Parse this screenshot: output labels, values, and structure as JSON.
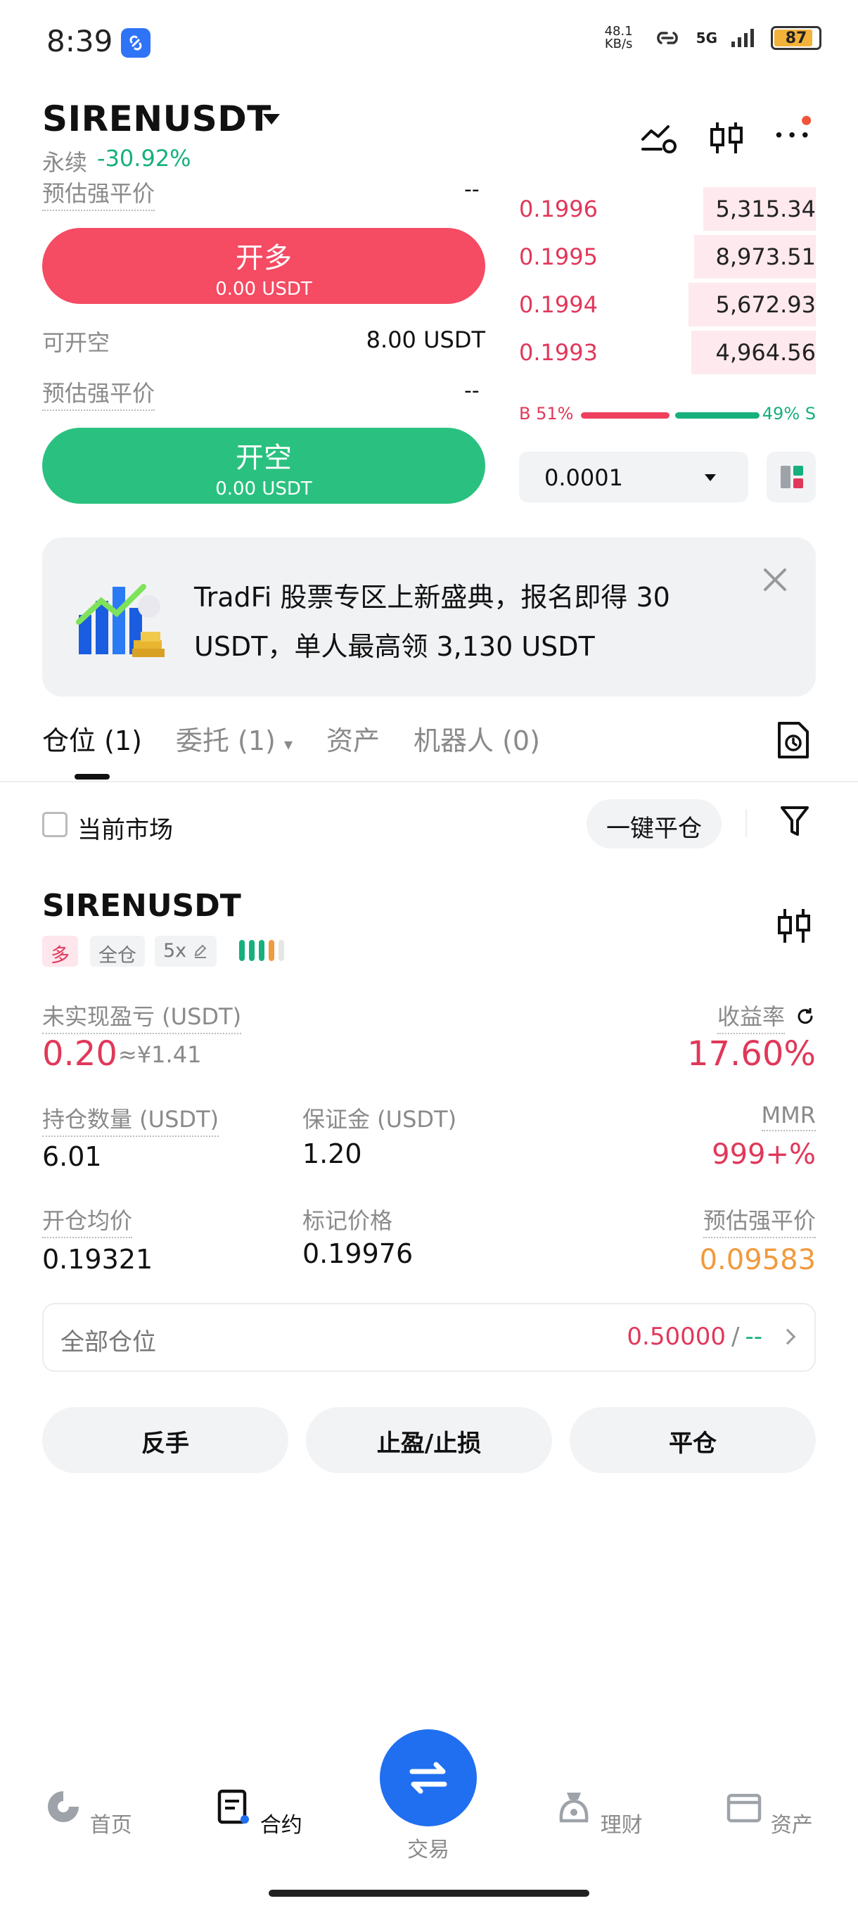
{
  "status_bar": {
    "time": "8:39",
    "net_speed": "48.1 KB/s",
    "network": "5G",
    "battery": "87"
  },
  "header": {
    "pair": "SIRENUSDT",
    "type": "永续",
    "change": "-30.92%"
  },
  "trade_panel": {
    "est_liq_label": "预估强平价",
    "est_liq_value": "--",
    "long_label": "开多",
    "long_amount": "0.00 USDT",
    "avail_short_label": "可开空",
    "avail_short_value": "8.00 USDT",
    "est_liq2_label": "预估强平价",
    "est_liq2_value": "--",
    "short_label": "开空",
    "short_amount": "0.00 USDT"
  },
  "orderbook": {
    "asks": [
      {
        "price": "0.1996",
        "size": "5,315.34",
        "depth": 0.38
      },
      {
        "price": "0.1995",
        "size": "8,973.51",
        "depth": 0.41
      },
      {
        "price": "0.1994",
        "size": "5,672.93",
        "depth": 0.43
      },
      {
        "price": "0.1993",
        "size": "4,964.56",
        "depth": 0.42
      }
    ],
    "buy_ratio": "B 51%",
    "sell_ratio": "49% S",
    "tick": "0.0001"
  },
  "banner": {
    "text": "TradFi 股票专区上新盛典，报名即得 30 USDT，单人最高领 3,130 USDT"
  },
  "tabs": [
    {
      "label": "仓位 (1)"
    },
    {
      "label": "委托 (1)"
    },
    {
      "label": "资产"
    },
    {
      "label": "机器人 (0)"
    }
  ],
  "filters": {
    "current_market": "当前市场",
    "close_all": "一键平仓"
  },
  "position": {
    "symbol": "SIRENUSDT",
    "side_tag": "多",
    "margin_tag": "全仓",
    "leverage_tag": "5x",
    "upl_label": "未实现盈亏 (USDT)",
    "upl_value": "0.20",
    "upl_cny": "≈¥1.41",
    "roe_label": "收益率",
    "roe_value": "17.60%",
    "qty_label": "持仓数量 (USDT)",
    "qty_value": "6.01",
    "margin_label": "保证金 (USDT)",
    "margin_value": "1.20",
    "mmr_label": "MMR",
    "mmr_value": "999+%",
    "entry_label": "开仓均价",
    "entry_value": "0.19321",
    "mark_label": "标记价格",
    "mark_value": "0.19976",
    "liq_label": "预估强平价",
    "liq_value": "0.09583",
    "all_positions_label": "全部仓位",
    "all_positions_value": "0.50000",
    "all_positions_sep": "/",
    "all_positions_dash": "--",
    "actions": {
      "reverse": "反手",
      "tpsl": "止盈/止损",
      "close": "平仓"
    }
  },
  "bottom_nav": {
    "home": "首页",
    "futures": "合约",
    "trade": "交易",
    "earn": "理财",
    "assets": "资产"
  },
  "colors": {
    "red": "#f54b63",
    "green": "#2ac180",
    "blue": "#1f6ff0",
    "orange": "#f19a3e"
  }
}
